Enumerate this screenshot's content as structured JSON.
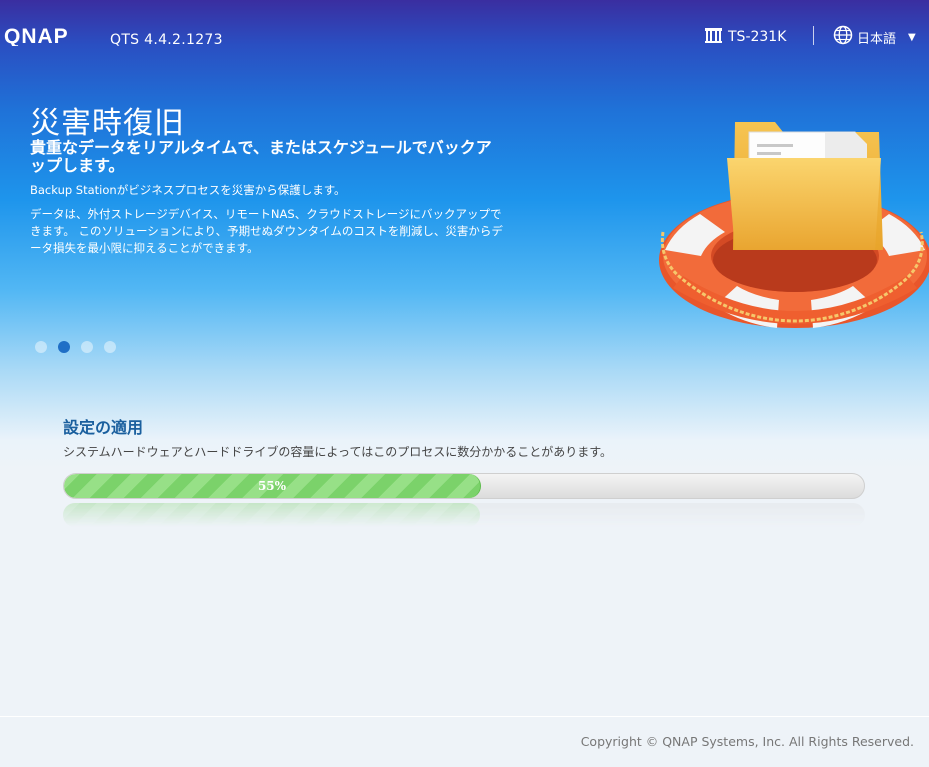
{
  "header": {
    "brand": "QNAP",
    "version": "QTS 4.4.2.1273",
    "model": "TS-231K",
    "language": "日本語"
  },
  "hero": {
    "title": "災害時復旧",
    "subtitle": "貴重なデータをリアルタイムで、またはスケジュールでバックアップします。",
    "description1": "Backup Stationがビジネスプロセスを災害から保護します。",
    "description2": "データは、外付ストレージデバイス、リモートNAS、クラウドストレージにバックアップできます。 このソリューションにより、予期せぬダウンタイムのコストを削減し、災害からデータ損失を最小限に抑えることができます。",
    "carousel": {
      "count": 4,
      "active_index": 1
    }
  },
  "status": {
    "title": "設定の適用",
    "description": "システムハードウェアとハードドライブの容量によってはこのプロセスに数分かかることがあります。",
    "progress_label": "55%",
    "progress_fraction": 0.52
  },
  "footer": {
    "copyright": "Copyright © QNAP Systems, Inc. All Rights Reserved."
  },
  "colors": {
    "accent": "#1a5f9e",
    "progress_green": "#7bd26a",
    "active_dot": "#1f6fc6"
  }
}
